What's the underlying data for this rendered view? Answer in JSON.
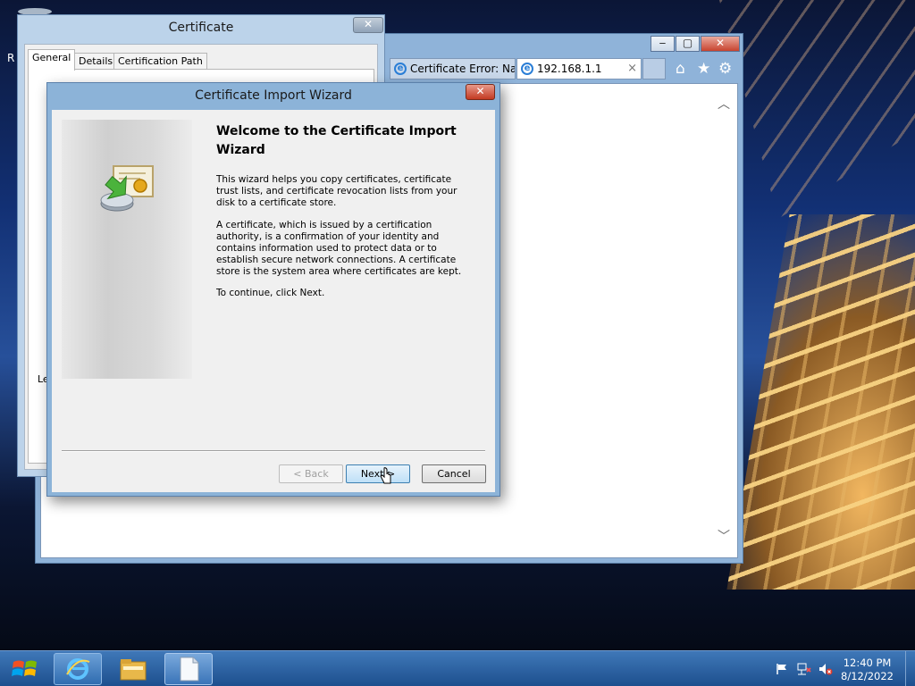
{
  "ie": {
    "tab1_label": "Certificate Error: Na...",
    "tab2_label": "192.168.1.1",
    "tab_close": "×",
    "minimize": "‒",
    "maximize": "▢",
    "close": "✕",
    "home_icon": "⌂",
    "favorites_icon": "★",
    "tools_icon": "⚙",
    "scroll_up": "︿",
    "scroll_down": "﹀"
  },
  "certificate_window": {
    "title": "Certificate",
    "close": "✕",
    "tabs": [
      "General",
      "Details",
      "Certification Path"
    ],
    "left_edge_text": "Le"
  },
  "background_window_edge_text": "R",
  "wizard": {
    "title": "Certificate Import Wizard",
    "close": "✕",
    "heading": "Welcome to the Certificate Import Wizard",
    "paragraph1": "This wizard helps you copy certificates, certificate trust lists, and certificate revocation lists from your disk to a certificate store.",
    "paragraph2": "A certificate, which is issued by a certification authority, is a confirmation of your identity and contains information used to protect data or to establish secure network connections. A certificate store is the system area where certificates are kept.",
    "paragraph3": "To continue, click Next.",
    "back_label": "< Back",
    "next_label": "Next >",
    "cancel_label": "Cancel"
  },
  "taskbar": {
    "time": "12:40 PM",
    "date": "8/12/2022"
  }
}
